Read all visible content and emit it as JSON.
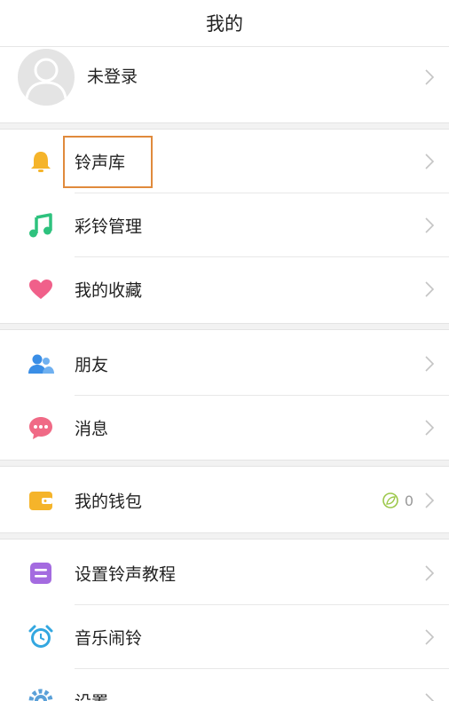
{
  "header": {
    "title": "我的"
  },
  "profile": {
    "label": "未登录"
  },
  "menu": {
    "ringtone_library": "铃声库",
    "crbt_manage": "彩铃管理",
    "favorites": "我的收藏",
    "friends": "朋友",
    "messages": "消息",
    "wallet": "我的钱包",
    "wallet_count": "0",
    "tutorial": "设置铃声教程",
    "music_alarm": "音乐闹铃",
    "settings": "设置"
  },
  "colors": {
    "accent_highlight": "#e08a3c",
    "bell_icon": "#f5b42a",
    "music_icon": "#2ec27e",
    "heart_icon": "#f0608a",
    "friends_icon": "#3a8ee6",
    "message_icon": "#f06a86",
    "wallet_icon": "#f5b42a",
    "tutorial_icon": "#a46be0",
    "alarm_icon": "#33a7e0",
    "settings_icon": "#5aa0d8"
  },
  "icons": {
    "avatar": "user-avatar-icon",
    "bell": "bell-icon",
    "music": "music-note-icon",
    "heart": "heart-icon",
    "friends": "friends-icon",
    "message": "chat-bubble-icon",
    "wallet": "wallet-icon",
    "coin": "leaf-coin-icon",
    "tutorial": "list-icon",
    "alarm": "alarm-clock-icon",
    "settings": "gear-icon",
    "chevron": "chevron-right-icon"
  }
}
